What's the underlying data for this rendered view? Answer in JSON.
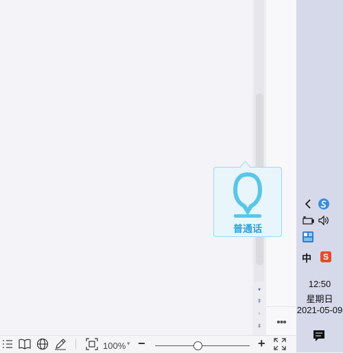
{
  "editor": {
    "more_label": "•••",
    "scroll_buttons": [
      "▾",
      "⇞",
      "▫",
      "⇟"
    ]
  },
  "voice_popup": {
    "label": "普通话"
  },
  "statusbar": {
    "zoom": "100%",
    "zoom_caret": "▾",
    "zoom_minus": "−",
    "zoom_plus": "+",
    "zoom_fraction": 0.45
  },
  "taskbar": {
    "time": "12:50",
    "weekday": "星期日",
    "date": "2021-05-09",
    "ime_label": "中",
    "sogou_label": "S"
  },
  "colors": {
    "accent": "#3a8ddb",
    "voice": "#5bc6e6",
    "sogou": "#e84b2a"
  }
}
